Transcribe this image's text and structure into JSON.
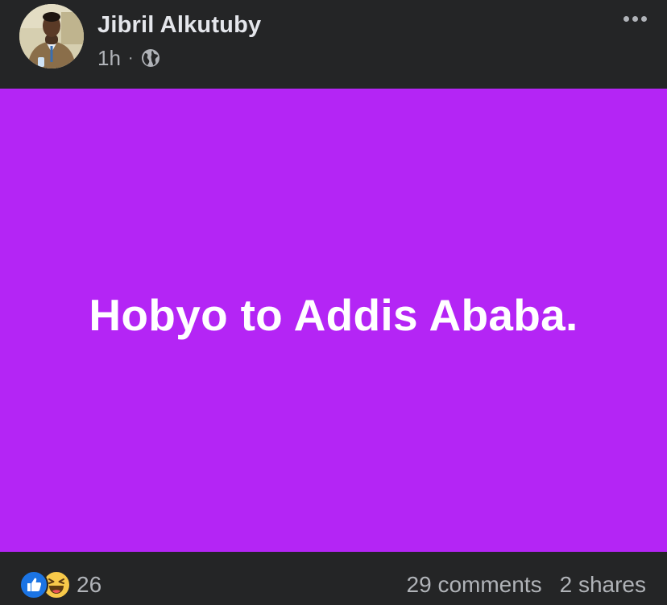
{
  "post": {
    "author": "Jibril Alkutuby",
    "time": "1h",
    "separator": "·",
    "privacy_icon": "globe-icon",
    "more_icon": "more-options-icon",
    "text": "Hobyo to Addis Ababa.",
    "background_color": "#b425f5"
  },
  "footer": {
    "reactions": [
      "like-icon",
      "haha-icon"
    ],
    "reaction_count": "26",
    "comments": "29 comments",
    "shares": "2 shares"
  }
}
